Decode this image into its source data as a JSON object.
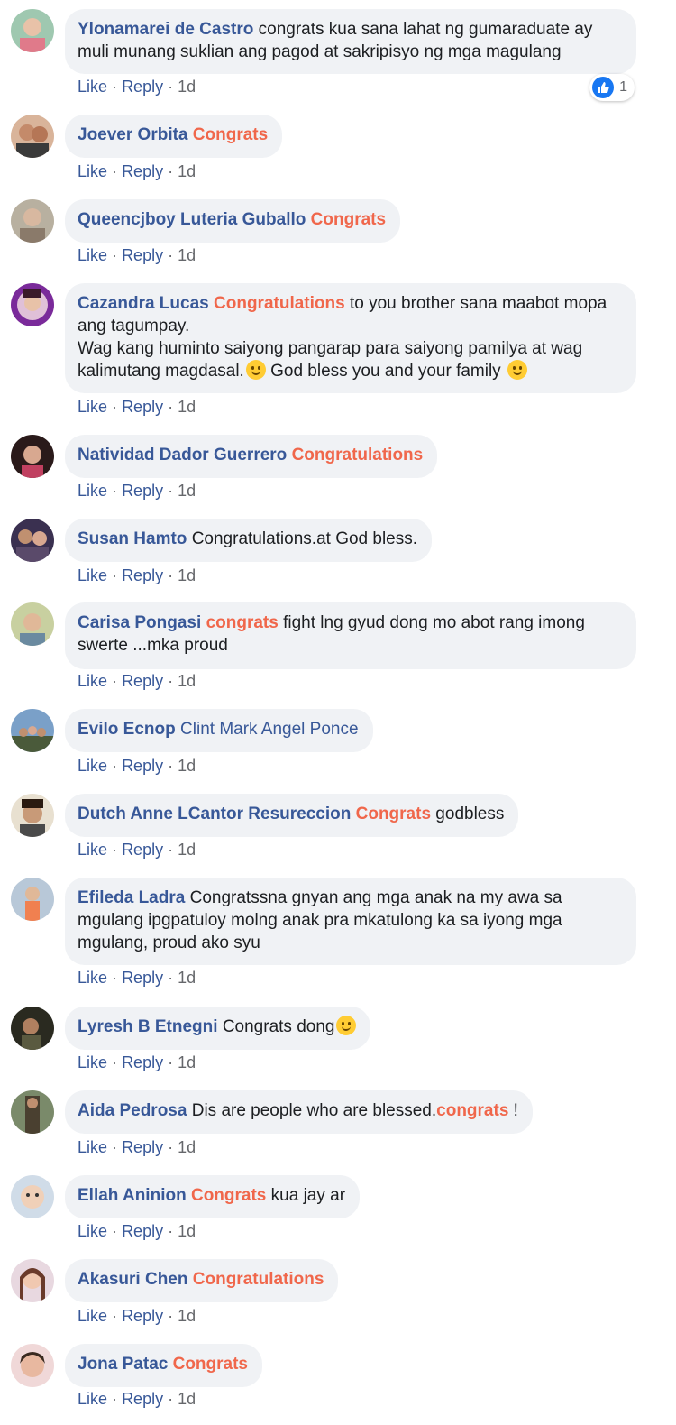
{
  "actions": {
    "like": "Like",
    "reply": "Reply",
    "sep": "·"
  },
  "comments": [
    {
      "author": "Ylonamarei de Castro",
      "text": " congrats kua sana lahat ng gumaraduate ay muli munang suklian ang pagod at sakripisyo ng mga magulang",
      "time": "1d",
      "reaction_count": "1"
    },
    {
      "author": "Joever Orbita",
      "highlight": "Congrats",
      "time": "1d"
    },
    {
      "author": "Queencjboy Luteria Guballo",
      "highlight": "Congrats",
      "time": "1d"
    },
    {
      "author": "Cazandra Lucas",
      "highlight": "Congratulations",
      "text": " to you brother sana maabot mopa ang tagumpay.",
      "text2": "Wag kang huminto saiyong pangarap para saiyong pamilya at wag kalimutang magdasal.",
      "text3": " God bless you and your family ",
      "time": "1d"
    },
    {
      "author": "Natividad Dador Guerrero",
      "highlight": "Congratulations",
      "time": "1d"
    },
    {
      "author": "Susan Hamto",
      "text": " Congratulations.at God bless.",
      "time": "1d"
    },
    {
      "author": "Carisa Pongasi",
      "highlight": "congrats",
      "text": " fight lng gyud dong mo abot rang imong swerte ...mka proud",
      "time": "1d"
    },
    {
      "author": "Evilo Ecnop",
      "mention": "Clint Mark Angel Ponce",
      "time": "1d"
    },
    {
      "author": "Dutch Anne LCantor Resureccion",
      "highlight": "Congrats",
      "text": " godbless",
      "time": "1d"
    },
    {
      "author": "Efileda Ladra",
      "text": " Congratssna gnyan ang mga anak na my awa sa mgulang ipgpatuloy molng anak pra mkatulong ka sa iyong mga mgulang, proud ako syu",
      "time": "1d"
    },
    {
      "author": "Lyresh B Etnegni",
      "text": " Congrats dong",
      "time": "1d"
    },
    {
      "author": "Aida Pedrosa",
      "text": " Dis are people who are blessed.",
      "highlight": "congrats",
      "text_after": " !",
      "time": "1d"
    },
    {
      "author": "Ellah Aninion",
      "highlight": "Congrats",
      "text": " kua jay ar",
      "time": "1d"
    },
    {
      "author": "Akasuri Chen",
      "highlight": "Congratulations",
      "time": "1d"
    },
    {
      "author": "Jona Patac",
      "highlight": "Congrats",
      "time": "1d"
    }
  ]
}
